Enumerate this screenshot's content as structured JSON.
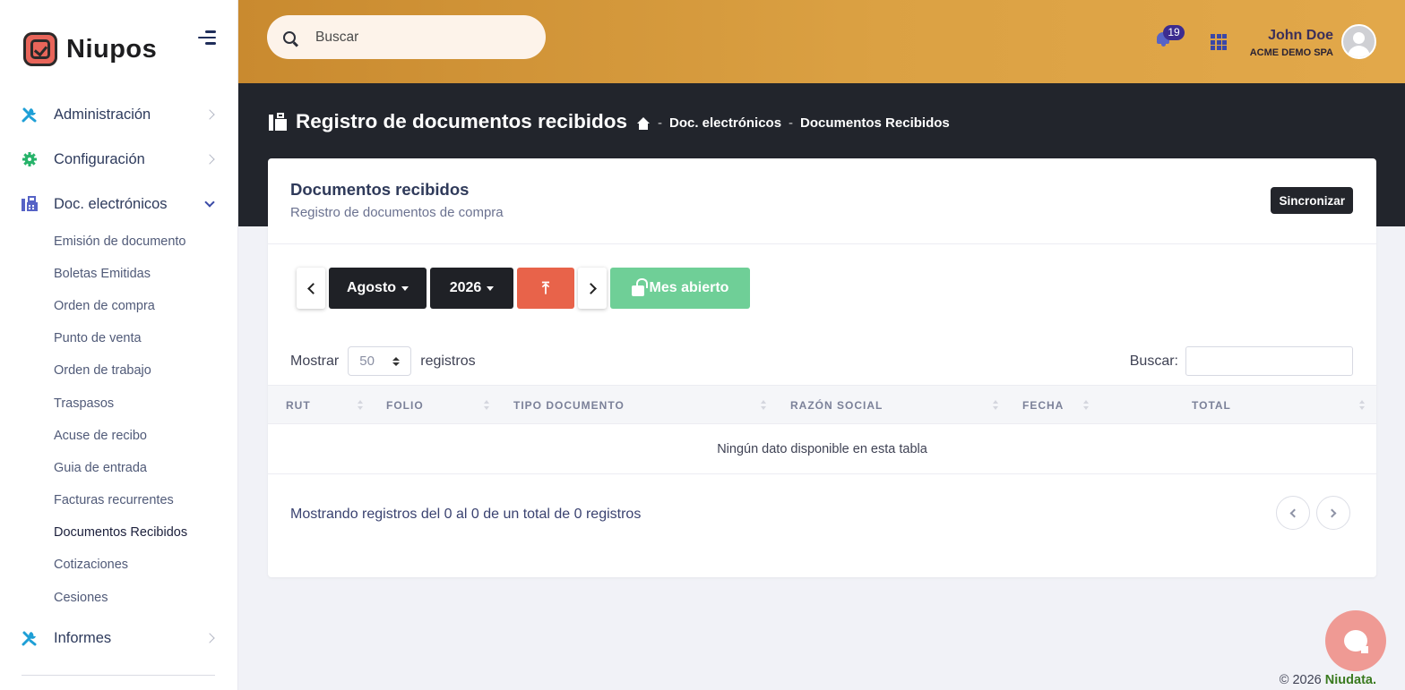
{
  "brand": {
    "name": "Niupos"
  },
  "search": {
    "placeholder": "Buscar"
  },
  "notifications": {
    "count": "19"
  },
  "user": {
    "name": "John Doe",
    "company": "ACME DEMO SPA"
  },
  "sidebar": {
    "items": [
      {
        "label": "Administración",
        "icon": "tools-icon"
      },
      {
        "label": "Configuración",
        "icon": "gear-icon"
      },
      {
        "label": "Doc. electrónicos",
        "icon": "fax-icon",
        "expanded": true
      },
      {
        "label": "Informes",
        "icon": "tools-icon"
      }
    ],
    "sub_items": [
      "Emisión de documento",
      "Boletas Emitidas",
      "Orden de compra",
      "Punto de venta",
      "Orden de trabajo",
      "Traspasos",
      "Acuse de recibo",
      "Guia de entrada",
      "Facturas recurrentes",
      "Documentos Recibidos",
      "Cotizaciones",
      "Cesiones"
    ],
    "active_sub_item": "Documentos Recibidos"
  },
  "page": {
    "title": "Registro de documentos recibidos",
    "breadcrumb": [
      "Doc. electrónicos",
      "Documentos Recibidos"
    ],
    "separator": "-"
  },
  "card": {
    "title": "Documentos recibidos",
    "subtitle": "Registro de documentos de compra",
    "sync_label": "Sincronizar"
  },
  "toolbar": {
    "month": "Agosto",
    "year": "2026",
    "export_glyph": "⤒",
    "open_label": "Mes abierto"
  },
  "table": {
    "show_label": "Mostrar",
    "page_size": "50",
    "records_label": "registros",
    "search_label": "Buscar:",
    "columns": [
      "RUT",
      "FOLIO",
      "TIPO DOCUMENTO",
      "RAZÓN SOCIAL",
      "FECHA",
      "TOTAL"
    ],
    "empty_message": "Ningún dato disponible en esta tabla",
    "info": "Mostrando registros del 0 al 0 de un total de 0 registros"
  },
  "footer": {
    "copyright": "© 2026",
    "company": "Niudata."
  },
  "colors": {
    "header_start": "#c98a2f",
    "header_end": "#e2a84a",
    "band": "#22252c",
    "export": "#e8634a",
    "open_month": "#6fcf97",
    "chat": "#ef9a94"
  }
}
